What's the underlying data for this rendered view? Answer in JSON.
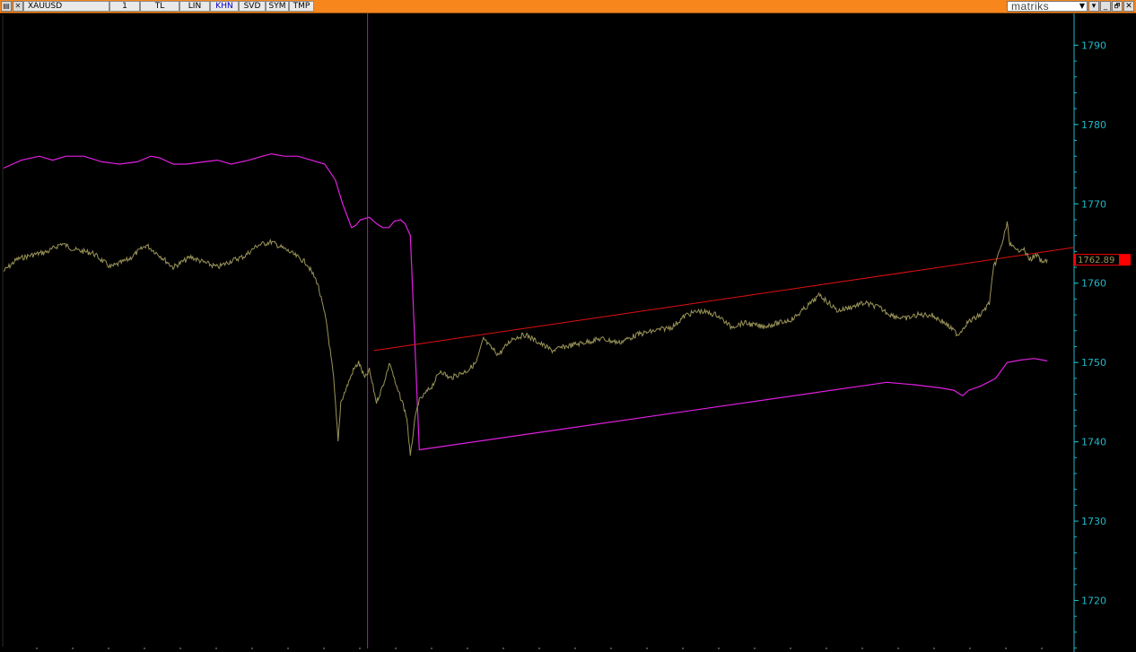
{
  "toolbar": {
    "symbol": "XAUUSD",
    "period": "1",
    "buttons": [
      {
        "label": "TL",
        "active": false
      },
      {
        "label": "LIN",
        "active": false
      },
      {
        "label": "KHN",
        "active": true
      },
      {
        "label": "SVD",
        "active": false
      },
      {
        "label": "SYM",
        "active": false
      },
      {
        "label": "TMP",
        "active": false
      }
    ],
    "brand": "matriks",
    "window_buttons": [
      "▾",
      "_",
      "🗗",
      "✕"
    ]
  },
  "colors": {
    "toolbar_bg": "#f7861c",
    "price_line": "#9a9458",
    "indicator_line": "#e020e0",
    "trend_line": "#e01010",
    "axis_text": "#1fb8c8",
    "last_price_tag": "#ff0000"
  },
  "chart_data": {
    "type": "line",
    "y_ticks": [
      1720,
      1730,
      1740,
      1750,
      1760,
      1770,
      1780,
      1790
    ],
    "ylim": [
      1713.5,
      1794
    ],
    "x_range": [
      0,
      1200
    ],
    "last_price_label": "1762.89",
    "grid": false,
    "series": [
      {
        "key": "price",
        "points": [
          [
            0,
            1761.5
          ],
          [
            15,
            1763
          ],
          [
            30,
            1763.5
          ],
          [
            50,
            1764
          ],
          [
            65,
            1765
          ],
          [
            80,
            1764.2
          ],
          [
            100,
            1763.8
          ],
          [
            120,
            1762
          ],
          [
            140,
            1763
          ],
          [
            160,
            1764.8
          ],
          [
            175,
            1763.5
          ],
          [
            190,
            1762
          ],
          [
            210,
            1763.3
          ],
          [
            225,
            1762.6
          ],
          [
            240,
            1762
          ],
          [
            255,
            1762.8
          ],
          [
            270,
            1763.4
          ],
          [
            285,
            1764.8
          ],
          [
            300,
            1765.2
          ],
          [
            320,
            1764
          ],
          [
            340,
            1762.5
          ],
          [
            352,
            1760
          ],
          [
            362,
            1755
          ],
          [
            370,
            1748
          ],
          [
            375,
            1740
          ],
          [
            378,
            1745
          ],
          [
            385,
            1747
          ],
          [
            392,
            1749
          ],
          [
            398,
            1750
          ],
          [
            405,
            1748
          ],
          [
            410,
            1749
          ],
          [
            418,
            1745
          ],
          [
            425,
            1747
          ],
          [
            433,
            1750
          ],
          [
            440,
            1747
          ],
          [
            447,
            1745
          ],
          [
            452,
            1743
          ],
          [
            456,
            1738
          ],
          [
            460,
            1742
          ],
          [
            465,
            1745
          ],
          [
            472,
            1746
          ],
          [
            480,
            1747
          ],
          [
            490,
            1749
          ],
          [
            500,
            1748
          ],
          [
            510,
            1748.5
          ],
          [
            520,
            1749
          ],
          [
            530,
            1750
          ],
          [
            538,
            1753
          ],
          [
            545,
            1752
          ],
          [
            555,
            1751
          ],
          [
            570,
            1753
          ],
          [
            585,
            1753.5
          ],
          [
            600,
            1752.5
          ],
          [
            615,
            1751.5
          ],
          [
            630,
            1752
          ],
          [
            650,
            1752.5
          ],
          [
            670,
            1753
          ],
          [
            690,
            1752.5
          ],
          [
            710,
            1753.5
          ],
          [
            730,
            1754
          ],
          [
            750,
            1754.5
          ],
          [
            765,
            1756
          ],
          [
            780,
            1756.5
          ],
          [
            800,
            1756
          ],
          [
            815,
            1754.5
          ],
          [
            830,
            1755
          ],
          [
            850,
            1754.5
          ],
          [
            870,
            1755
          ],
          [
            885,
            1755.5
          ],
          [
            900,
            1757
          ],
          [
            915,
            1758.5
          ],
          [
            925,
            1757.5
          ],
          [
            935,
            1756.5
          ],
          [
            950,
            1757
          ],
          [
            965,
            1757.5
          ],
          [
            980,
            1757
          ],
          [
            995,
            1756
          ],
          [
            1010,
            1755.5
          ],
          [
            1025,
            1756
          ],
          [
            1040,
            1756
          ],
          [
            1055,
            1755
          ],
          [
            1065,
            1754
          ],
          [
            1070,
            1753.5
          ],
          [
            1080,
            1755
          ],
          [
            1095,
            1756
          ],
          [
            1105,
            1757.5
          ],
          [
            1110,
            1762
          ],
          [
            1118,
            1764.5
          ],
          [
            1125,
            1767.5
          ],
          [
            1128,
            1765
          ],
          [
            1135,
            1764
          ],
          [
            1142,
            1764.5
          ],
          [
            1150,
            1763
          ],
          [
            1158,
            1763.5
          ],
          [
            1165,
            1762.5
          ],
          [
            1170,
            1763
          ]
        ]
      },
      {
        "key": "indicator",
        "points": [
          [
            0,
            1774.5
          ],
          [
            20,
            1775.5
          ],
          [
            40,
            1776
          ],
          [
            55,
            1775.5
          ],
          [
            70,
            1776
          ],
          [
            90,
            1776
          ],
          [
            110,
            1775.3
          ],
          [
            130,
            1775
          ],
          [
            150,
            1775.3
          ],
          [
            165,
            1776
          ],
          [
            175,
            1775.8
          ],
          [
            190,
            1775
          ],
          [
            205,
            1775
          ],
          [
            225,
            1775.3
          ],
          [
            240,
            1775.5
          ],
          [
            255,
            1775
          ],
          [
            275,
            1775.5
          ],
          [
            290,
            1776
          ],
          [
            300,
            1776.3
          ],
          [
            315,
            1776
          ],
          [
            330,
            1776
          ],
          [
            345,
            1775.5
          ],
          [
            360,
            1775
          ],
          [
            372,
            1773
          ],
          [
            380,
            1770
          ],
          [
            385,
            1768.5
          ],
          [
            390,
            1767
          ],
          [
            395,
            1767.3
          ],
          [
            400,
            1768
          ],
          [
            410,
            1768.3
          ],
          [
            418,
            1767.5
          ],
          [
            425,
            1767
          ],
          [
            432,
            1767
          ],
          [
            438,
            1767.8
          ],
          [
            445,
            1768
          ],
          [
            450,
            1767.5
          ],
          [
            456,
            1766
          ],
          [
            466,
            1739
          ],
          [
            990,
            1747.5
          ],
          [
            1020,
            1747.2
          ],
          [
            1050,
            1746.8
          ],
          [
            1065,
            1746.5
          ],
          [
            1075,
            1745.8
          ],
          [
            1082,
            1746.5
          ],
          [
            1095,
            1747
          ],
          [
            1112,
            1748
          ],
          [
            1125,
            1750
          ],
          [
            1140,
            1750.3
          ],
          [
            1155,
            1750.5
          ],
          [
            1170,
            1750.2
          ]
        ]
      }
    ],
    "trend_line": {
      "from": [
        415,
        1751.5
      ],
      "to": [
        1200,
        1764.5
      ]
    },
    "vertical_marker_x": 408
  }
}
